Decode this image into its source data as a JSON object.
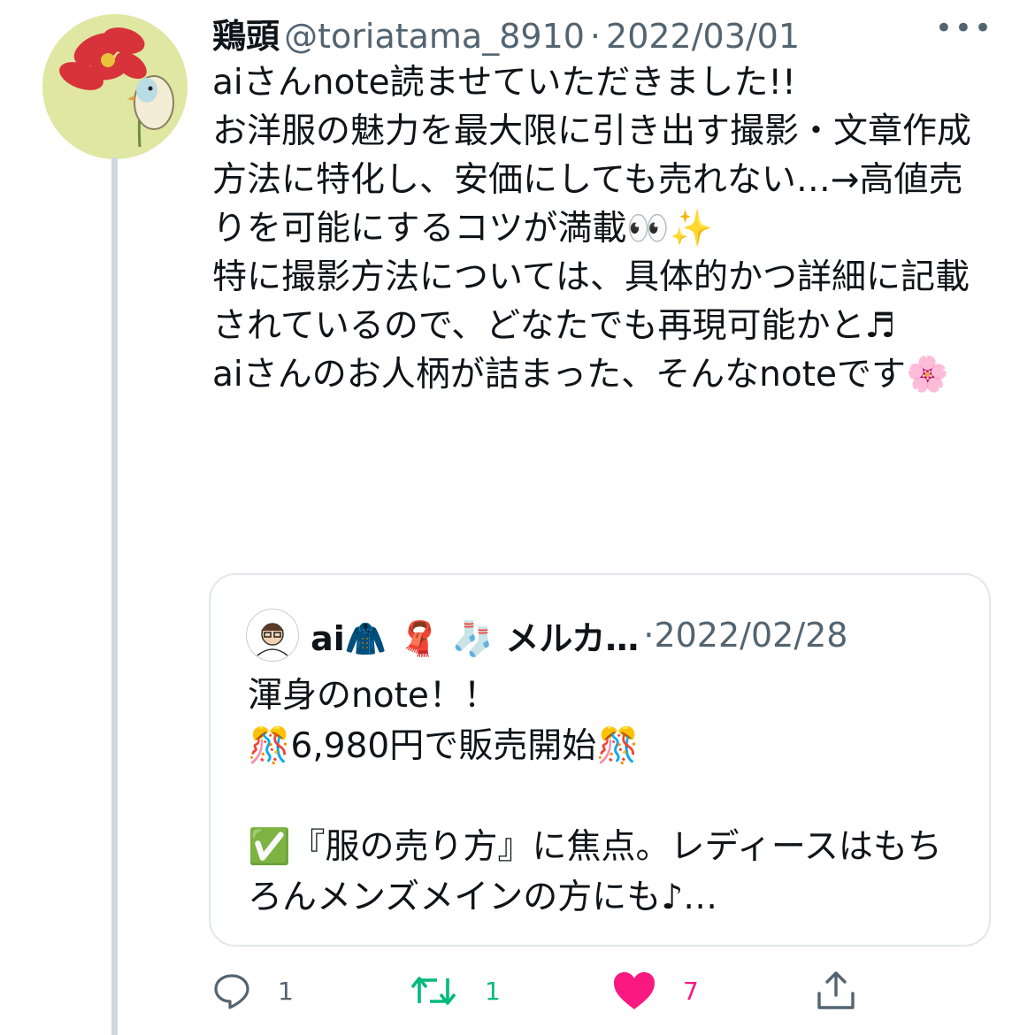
{
  "tweet": {
    "author_name": "鶏頭",
    "handle": "@toriatama_8910",
    "separator": "·",
    "date": "2022/03/01",
    "more_label": "•••",
    "text": "aiさんnote読ませていただきました!!\nお洋服の魅力を最大限に引き出す撮影・文章作成方法に特化し、安価にしても売れない…→高値売りを可能にするコツが満載👀✨\n特に撮影方法については、具体的かつ詳細に記載されているので、どなたでも再現可能かと♬\naiさんのお人柄が詰まった、そんなnoteです🌸"
  },
  "quote": {
    "author_name": "ai🧥 🧣 🧦 メルカ…",
    "separator": "·",
    "date": "2022/02/28",
    "text": "渾身のnote！！\n🎊6,980円で販売開始🎊\n\n✅『服の売り方』に焦点。レディースはもちろんメンズメインの方にも♪…"
  },
  "actions": {
    "reply_count": "1",
    "retweet_count": "1",
    "like_count": "7"
  },
  "colors": {
    "secondary_text": "#536471",
    "retweet_green": "#00ba7c",
    "like_pink": "#f91880",
    "border": "#e1e8ed"
  },
  "icons": {
    "reply": "reply-icon",
    "retweet": "retweet-icon",
    "like": "heart-icon",
    "share": "share-icon",
    "more": "more-icon"
  }
}
